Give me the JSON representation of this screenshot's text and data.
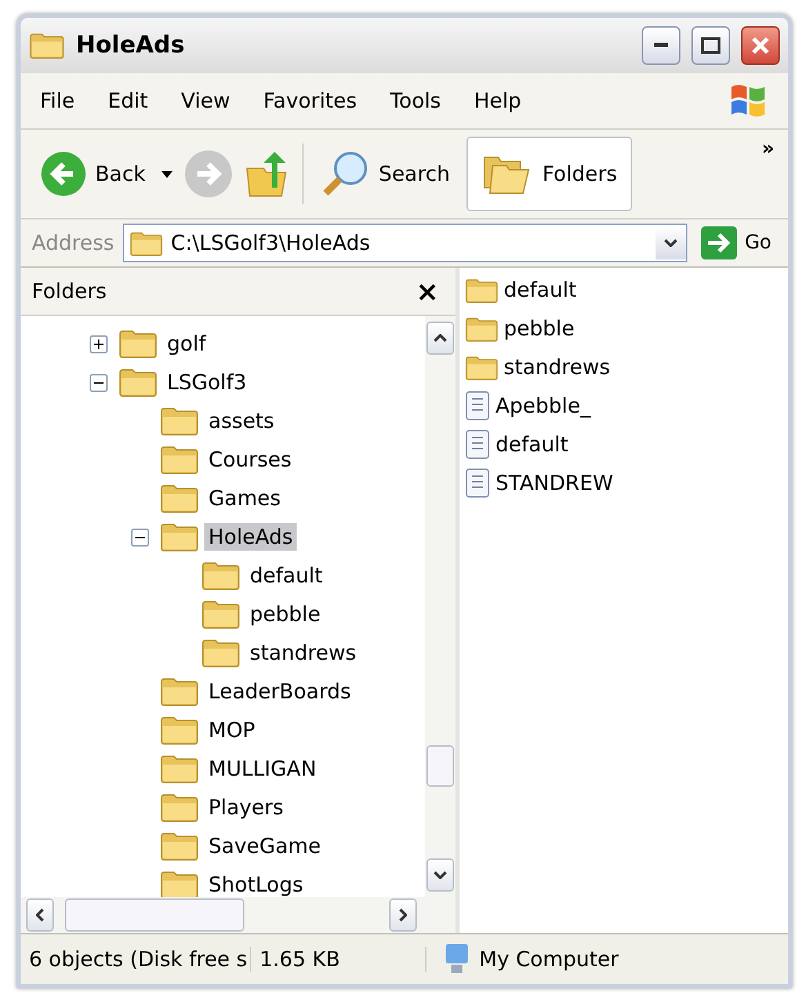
{
  "window": {
    "title": "HoleAds"
  },
  "menu": [
    "File",
    "Edit",
    "View",
    "Favorites",
    "Tools",
    "Help"
  ],
  "toolbar": {
    "back": "Back",
    "search": "Search",
    "folders": "Folders",
    "more": "»"
  },
  "address": {
    "label": "Address",
    "value": "C:\\LSGolf3\\HoleAds",
    "go": "Go"
  },
  "folders_pane": {
    "title": "Folders",
    "close": "×",
    "tree": [
      {
        "label": "golf",
        "kind": "node",
        "expanded": false,
        "selected": false
      },
      {
        "label": "LSGolf3",
        "kind": "node",
        "expanded": true,
        "selected": false,
        "children": [
          {
            "label": "assets",
            "kind": "leaf",
            "selected": false
          },
          {
            "label": "Courses",
            "kind": "leaf",
            "selected": false
          },
          {
            "label": "Games",
            "kind": "leaf",
            "selected": false
          },
          {
            "label": "HoleAds",
            "kind": "node",
            "expanded": true,
            "selected": true,
            "children": [
              {
                "label": "default",
                "kind": "leaf",
                "selected": false
              },
              {
                "label": "pebble",
                "kind": "leaf",
                "selected": false
              },
              {
                "label": "standrews",
                "kind": "leaf",
                "selected": false
              }
            ]
          },
          {
            "label": "LeaderBoards",
            "kind": "leaf",
            "selected": false
          },
          {
            "label": "MOP",
            "kind": "leaf",
            "selected": false
          },
          {
            "label": "MULLIGAN",
            "kind": "leaf",
            "selected": false
          },
          {
            "label": "Players",
            "kind": "leaf",
            "selected": false
          },
          {
            "label": "SaveGame",
            "kind": "leaf",
            "selected": false
          },
          {
            "label": "ShotLogs",
            "kind": "leaf",
            "selected": false
          }
        ]
      }
    ]
  },
  "files": [
    {
      "name": "default",
      "kind": "folder"
    },
    {
      "name": "pebble",
      "kind": "folder"
    },
    {
      "name": "standrews",
      "kind": "folder"
    },
    {
      "name": "Apebble_",
      "kind": "file"
    },
    {
      "name": "default",
      "kind": "file"
    },
    {
      "name": "STANDREW",
      "kind": "file"
    }
  ],
  "status_bar": {
    "objects": "6 objects (Disk free s",
    "size": "1.65 KB",
    "zone": "My Computer"
  }
}
